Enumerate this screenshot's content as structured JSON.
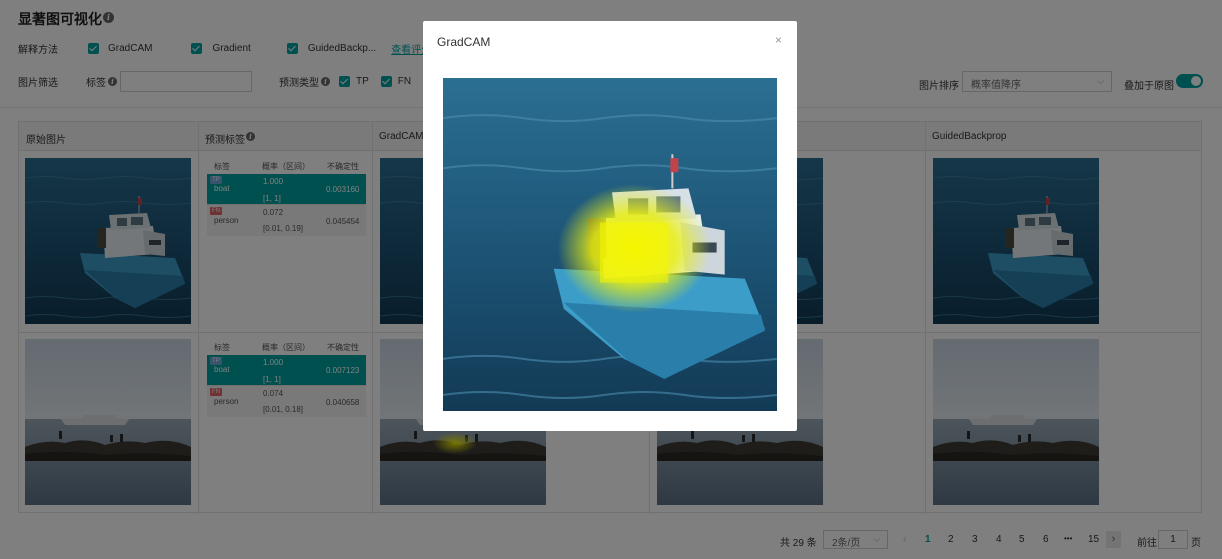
{
  "header": {
    "title": "显著图可视化"
  },
  "filters": {
    "explain_label": "解释方法",
    "methods": [
      "GradCAM",
      "Gradient",
      "GuidedBackp..."
    ],
    "view_link": "查看评分",
    "image_filter_label": "图片筛选",
    "tag_label": "标签",
    "tag_input_value": "",
    "pred_type_label": "预测类型",
    "pred_types": [
      "TP",
      "FN"
    ],
    "sort_label": "图片排序",
    "sort_value": "概率值降序",
    "overlay_label": "叠加于原图"
  },
  "table": {
    "columns": [
      "原始图片",
      "预测标签",
      "GradCAM",
      "GuidedBackprop"
    ],
    "pred_headers": [
      "标签",
      "概率（区间）",
      "不确定性"
    ],
    "rows": [
      {
        "preds": [
          {
            "type": "TP",
            "label": "boat",
            "prob": "1.000",
            "interval": "[1, 1]",
            "uncertainty": "0.003160"
          },
          {
            "type": "FN",
            "label": "person",
            "prob": "0.072",
            "interval": "[0.01, 0.19]",
            "uncertainty": "0.045454"
          }
        ]
      },
      {
        "preds": [
          {
            "type": "TP",
            "label": "boat",
            "prob": "1.000",
            "interval": "[1, 1]",
            "uncertainty": "0.007123"
          },
          {
            "type": "FN",
            "label": "person",
            "prob": "0.074",
            "interval": "[0.01, 0.18]",
            "uncertainty": "0.040658"
          }
        ]
      }
    ]
  },
  "pagination": {
    "total": "共 29 条",
    "page_size": "2条/页",
    "pages": [
      "1",
      "2",
      "3",
      "4",
      "5",
      "6",
      "•••",
      "15"
    ],
    "prev": "‹",
    "next": "›",
    "goto_label": "前往",
    "goto_value": "1",
    "goto_suffix": "页",
    "current_page": 1
  },
  "modal": {
    "title": "GradCAM",
    "close": "×"
  },
  "colors": {
    "accent": "#00a0a0",
    "fn_badge": "#e06464",
    "tp_badge": "#6fa9d8",
    "heat": "#f0f000"
  },
  "icons": {
    "info": "info-icon",
    "check": "check-icon",
    "close": "close-icon",
    "chevron": "chevron-down-icon"
  }
}
